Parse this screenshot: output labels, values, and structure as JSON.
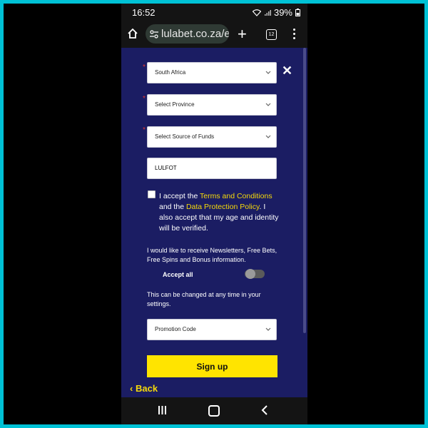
{
  "status_bar": {
    "time": "16:52",
    "battery": "39%"
  },
  "browser": {
    "url": "lulabet.co.za/e|",
    "tab_count": "12"
  },
  "form": {
    "country_select": {
      "value": "South Africa"
    },
    "province_select": {
      "value": "Select Province"
    },
    "source_of_funds_select": {
      "value": "Select Source of Funds"
    },
    "text_field": {
      "value": "LULFOT"
    },
    "terms": {
      "prefix": "I accept the ",
      "terms_link": "Terms and Conditions",
      "middle": " and the ",
      "policy_link": "Data Protection Policy",
      "suffix": ". I also accept that my age and identity will be verified."
    },
    "newsletter_text": "I would like to receive Newsletters, Free Bets, Free Spins and Bonus information.",
    "accept_all_label": "Accept all",
    "change_note": "This can be changed at any time in your settings.",
    "promo_select": {
      "value": "Promotion Code"
    },
    "signup_label": "Sign up",
    "back_label": "Back",
    "required_marker": "*"
  },
  "colors": {
    "accent": "#ffe400",
    "link": "#f5d90a",
    "background": "#1b1d63"
  },
  "icons": [
    "home-icon",
    "tune-icon",
    "plus-icon",
    "tabs-icon",
    "menu-icon",
    "close-icon",
    "chevron-down-icon",
    "chevron-left-icon",
    "recents-icon",
    "home-nav-icon",
    "back-nav-icon"
  ]
}
